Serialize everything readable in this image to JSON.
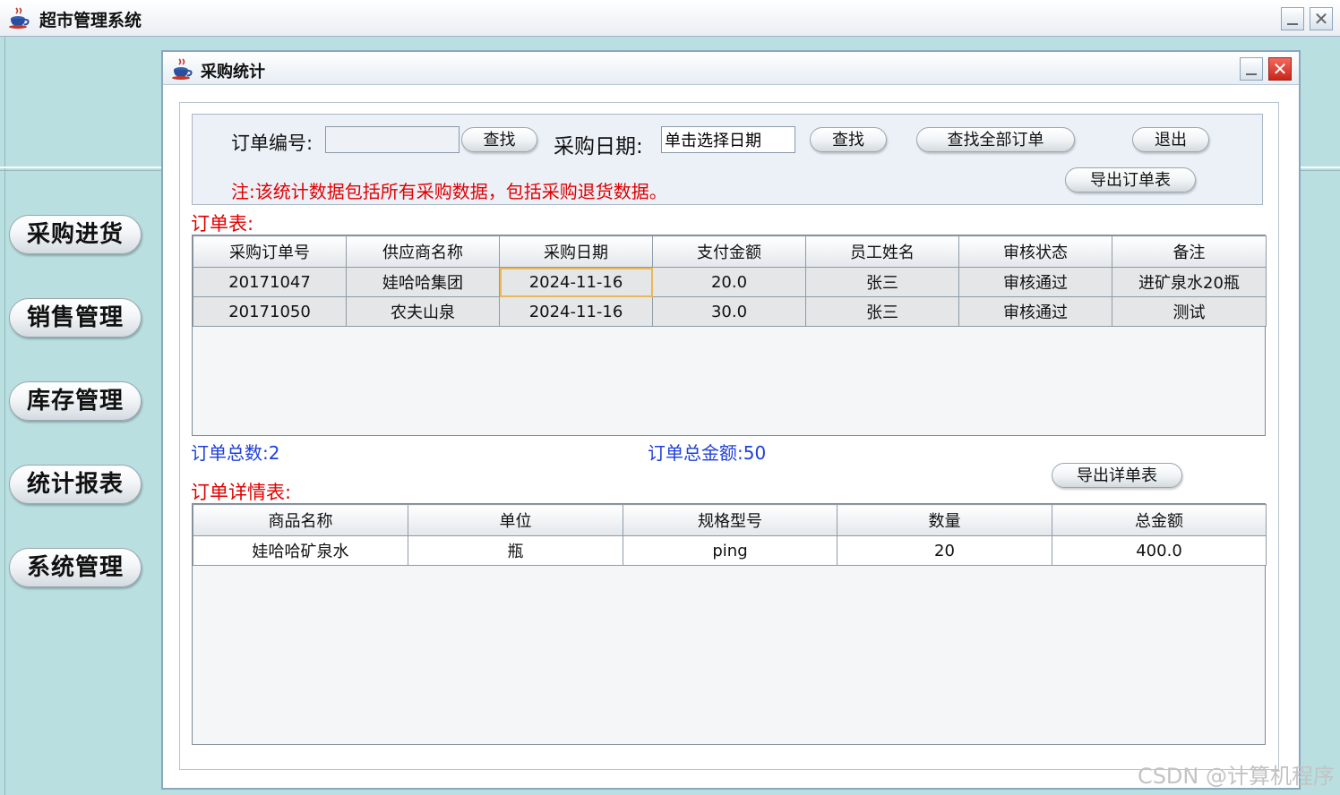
{
  "window": {
    "title": "超市管理系统"
  },
  "sidebar": {
    "items": [
      {
        "label": "采购进货"
      },
      {
        "label": "销售管理"
      },
      {
        "label": "库存管理"
      },
      {
        "label": "统计报表"
      },
      {
        "label": "系统管理"
      }
    ]
  },
  "dialog": {
    "title": "采购统计",
    "search": {
      "order_no_label": "订单编号:",
      "order_no_value": "",
      "find_label": "查找",
      "date_label": "采购日期:",
      "date_value": "单击选择日期",
      "find2_label": "查找",
      "find_all_label": "查找全部订单",
      "exit_label": "退出",
      "export_orders_label": "导出订单表",
      "note": "注:该统计数据包括所有采购数据，包括采购退货数据。"
    },
    "orders": {
      "title": "订单表:",
      "columns": [
        "采购订单号",
        "供应商名称",
        "采购日期",
        "支付金额",
        "员工姓名",
        "审核状态",
        "备注"
      ],
      "rows": [
        [
          "20171047",
          "娃哈哈集团",
          "2024-11-16",
          "20.0",
          "张三",
          "审核通过",
          "进矿泉水20瓶"
        ],
        [
          "20171050",
          "农夫山泉",
          "2024-11-16",
          "30.0",
          "张三",
          "审核通过",
          "测试"
        ]
      ],
      "total_count_label": "订单总数:2",
      "total_amount_label": "订单总金额:50"
    },
    "details": {
      "title": "订单详情表:",
      "export_label": "导出详单表",
      "columns": [
        "商品名称",
        "单位",
        "规格型号",
        "数量",
        "总金额"
      ],
      "rows": [
        [
          "娃哈哈矿泉水",
          "瓶",
          "ping",
          "20",
          "400.0"
        ]
      ]
    }
  },
  "watermark": "CSDN @计算机程序",
  "colors": {
    "desktop": "#b9dfe0",
    "note_red": "#e00000",
    "summary_blue": "#2040d8",
    "selection": "#e8b85a"
  }
}
